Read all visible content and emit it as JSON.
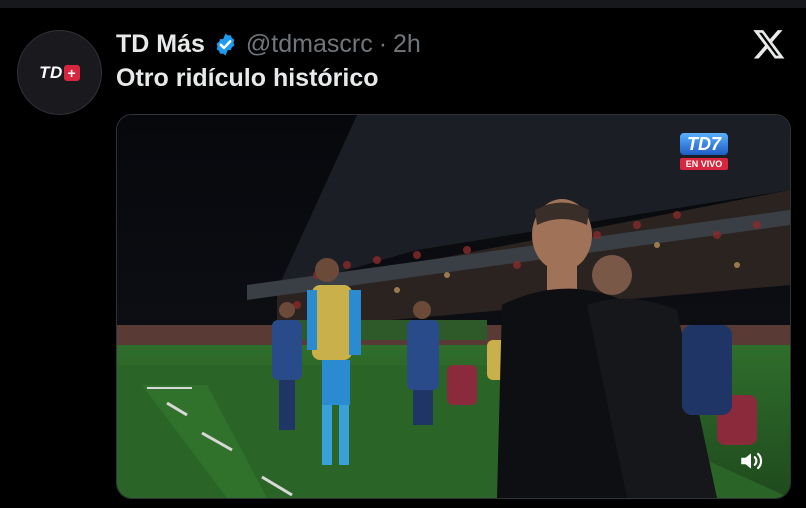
{
  "tweet": {
    "avatar_label": "TD",
    "avatar_plus": "+",
    "display_name": "TD Más",
    "handle": "@tdmascrc",
    "separator": "·",
    "time": "2h",
    "text": "Otro ridículo histórico",
    "verified_color": "#1d9bf0"
  },
  "media": {
    "broadcast_logo": "TD7",
    "live_badge": "EN VIVO",
    "volume_icon": "speaker-wave-icon"
  },
  "icons": {
    "close": "x-logo-icon",
    "verified": "verified-badge-icon"
  }
}
